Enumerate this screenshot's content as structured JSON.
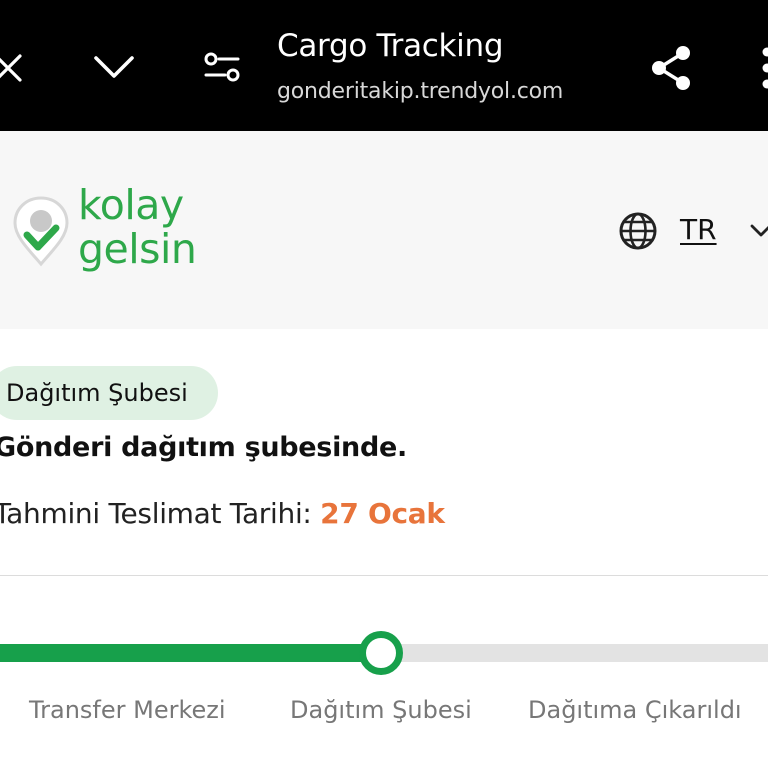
{
  "browser": {
    "title": "Cargo Tracking",
    "url": "gonderitakip.trendyol.com",
    "icons": [
      "close-icon",
      "chevron-down-icon",
      "page-info-icon",
      "share-icon",
      "more-menu-icon"
    ]
  },
  "header": {
    "logo_line1": "kolay",
    "logo_line2": "gelsin",
    "language": "TR",
    "brand_color": "#2ea84a"
  },
  "status": {
    "badge": "Dağıtım Şubesi",
    "message": "Gönderi dağıtım şubesinde.",
    "eta_label": "Tahmini Teslimat Tarihi:",
    "eta_value": "27 Ocak",
    "eta_color": "#e8743b"
  },
  "progress": {
    "steps": [
      "Transfer Merkezi",
      "Dağıtım Şubesi",
      "Dağıtıma Çıkarıldı"
    ],
    "current_step_index": 1,
    "accent_color": "#17a04b"
  }
}
